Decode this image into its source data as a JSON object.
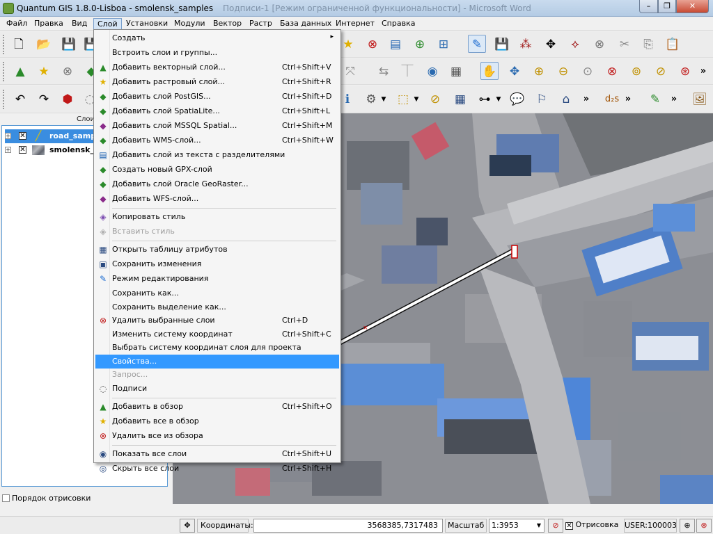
{
  "window": {
    "title": "Quantum GIS 1.8.0-Lisboa - smolensk_samples",
    "background_title": "Подписи-1 [Режим ограниченной функциональности] - Microsoft Word"
  },
  "menubar": [
    "Файл",
    "Правка",
    "Вид",
    "Слой",
    "Установки",
    "Модули",
    "Вектор",
    "Растр",
    "База данных",
    "Интернет",
    "Справка"
  ],
  "active_menu": "Слой",
  "layers_panel": {
    "title": "Слои",
    "layers": [
      {
        "name": "road_samples",
        "checked": true,
        "selected": true,
        "icon": "line-layer-icon"
      },
      {
        "name": "smolensk_samples",
        "checked": true,
        "selected": false,
        "icon": "raster-layer-icon"
      }
    ],
    "render_order_label": "Порядок отрисовки"
  },
  "layer_menu": [
    {
      "type": "item",
      "label": "Создать",
      "shortcut": "",
      "icon": "",
      "submenu": true,
      "disabled": false
    },
    {
      "type": "item",
      "label": "Встроить слои и группы...",
      "shortcut": "",
      "icon": "",
      "disabled": false
    },
    {
      "type": "item",
      "label": "Добавить векторный слой...",
      "shortcut": "Ctrl+Shift+V",
      "icon": "add-vector-icon",
      "disabled": false
    },
    {
      "type": "item",
      "label": "Добавить растровый слой...",
      "shortcut": "Ctrl+Shift+R",
      "icon": "add-raster-icon",
      "disabled": false
    },
    {
      "type": "item",
      "label": "Добавить слой PostGIS...",
      "shortcut": "Ctrl+Shift+D",
      "icon": "add-postgis-icon",
      "disabled": false
    },
    {
      "type": "item",
      "label": "Добавить слой SpatiaLite...",
      "shortcut": "Ctrl+Shift+L",
      "icon": "add-spatialite-icon",
      "disabled": false
    },
    {
      "type": "item",
      "label": "Добавить слой MSSQL Spatial...",
      "shortcut": "Ctrl+Shift+M",
      "icon": "add-mssql-icon",
      "disabled": false
    },
    {
      "type": "item",
      "label": "Добавить WMS-слой...",
      "shortcut": "Ctrl+Shift+W",
      "icon": "add-wms-icon",
      "disabled": false
    },
    {
      "type": "item",
      "label": "Добавить слой из текста с разделителями",
      "shortcut": "",
      "icon": "add-delimited-text-icon",
      "disabled": false
    },
    {
      "type": "item",
      "label": "Создать новый GPX-слой",
      "shortcut": "",
      "icon": "new-gpx-icon",
      "disabled": false
    },
    {
      "type": "item",
      "label": "Добавить слой Oracle GeoRaster...",
      "shortcut": "",
      "icon": "add-oracle-icon",
      "disabled": false
    },
    {
      "type": "item",
      "label": "Добавить WFS-слой...",
      "shortcut": "",
      "icon": "add-wfs-icon",
      "disabled": false
    },
    {
      "type": "sep"
    },
    {
      "type": "item",
      "label": "Копировать стиль",
      "shortcut": "",
      "icon": "copy-style-icon",
      "disabled": false
    },
    {
      "type": "item",
      "label": "Вставить стиль",
      "shortcut": "",
      "icon": "paste-style-icon",
      "disabled": true
    },
    {
      "type": "sep"
    },
    {
      "type": "item",
      "label": "Открыть таблицу атрибутов",
      "shortcut": "",
      "icon": "attribute-table-icon",
      "disabled": false
    },
    {
      "type": "item",
      "label": "Сохранить изменения",
      "shortcut": "",
      "icon": "save-edits-icon",
      "disabled": false
    },
    {
      "type": "item",
      "label": "Режим редактирования",
      "shortcut": "",
      "icon": "toggle-edit-icon",
      "disabled": false
    },
    {
      "type": "item",
      "label": "Сохранить как...",
      "shortcut": "",
      "icon": "",
      "disabled": false
    },
    {
      "type": "item",
      "label": "Сохранить выделение как...",
      "shortcut": "",
      "icon": "",
      "disabled": false
    },
    {
      "type": "item",
      "label": "Удалить выбранные слои",
      "shortcut": "Ctrl+D",
      "icon": "remove-layer-icon",
      "disabled": false
    },
    {
      "type": "item",
      "label": "Изменить систему координат",
      "shortcut": "Ctrl+Shift+C",
      "icon": "",
      "disabled": false
    },
    {
      "type": "item",
      "label": "Выбрать систему координат слоя для проекта",
      "shortcut": "",
      "icon": "",
      "disabled": false
    },
    {
      "type": "item",
      "label": "Свойства...",
      "shortcut": "",
      "icon": "",
      "disabled": false,
      "highlighted": true
    },
    {
      "type": "item",
      "label": "Запрос...",
      "shortcut": "",
      "icon": "",
      "disabled": true
    },
    {
      "type": "item",
      "label": "Подписи",
      "shortcut": "",
      "icon": "labeling-icon",
      "disabled": false
    },
    {
      "type": "sep"
    },
    {
      "type": "item",
      "label": "Добавить в обзор",
      "shortcut": "Ctrl+Shift+O",
      "icon": "add-to-overview-icon",
      "disabled": false
    },
    {
      "type": "item",
      "label": "Добавить все в обзор",
      "shortcut": "",
      "icon": "add-all-overview-icon",
      "disabled": false
    },
    {
      "type": "item",
      "label": "Удалить все из обзора",
      "shortcut": "",
      "icon": "remove-all-overview-icon",
      "disabled": false
    },
    {
      "type": "sep"
    },
    {
      "type": "item",
      "label": "Показать все слои",
      "shortcut": "Ctrl+Shift+U",
      "icon": "show-all-layers-icon",
      "disabled": false
    },
    {
      "type": "item",
      "label": "Скрыть все слои",
      "shortcut": "Ctrl+Shift+H",
      "icon": "hide-all-layers-icon",
      "disabled": false
    }
  ],
  "statusbar": {
    "coords_label": "Координаты:",
    "coords_value": "3568385,7317483",
    "scale_label": "Масштаб",
    "scale_value": "1:3953",
    "render_label": "Отрисовка",
    "render_checked": true,
    "crs": "USER:100003"
  }
}
